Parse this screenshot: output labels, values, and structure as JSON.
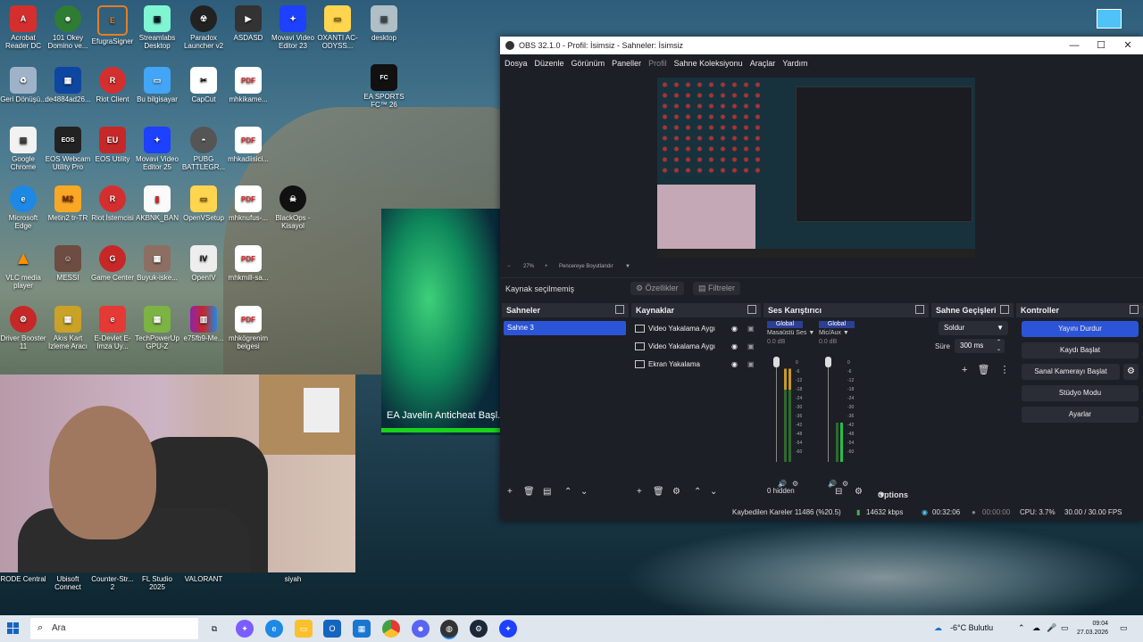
{
  "desktop": {
    "icons_col1": [
      "Acrobat Reader DC",
      "Geri Dönüşü...",
      "Google Chrome",
      "Microsoft Edge",
      "VLC media player",
      "Driver Booster 11"
    ],
    "icons_col2": [
      "101 Okey Domino ve...",
      "de4884ad26...",
      "EOS Webcam Utility Pro",
      "Metin2 tr-TR",
      "MESSI",
      "Akıs Kart İzleme Aracı"
    ],
    "icons_col3": [
      "EfugraSigner",
      "Riot Client",
      "EOS Utility",
      "Riot İstemcisi",
      "Game Center",
      "E-Devlet E-İmza Uy..."
    ],
    "icons_col4": [
      "Streamlabs Desktop",
      "Bu bilgisayar",
      "Movavi Video Editor 25",
      "AKBNK_BAN",
      "Buyuk-iske...",
      "TechPowerUp GPU-Z"
    ],
    "icons_col5": [
      "Paradox Launcher v2",
      "CapCut",
      "PUBG BATTLEGR...",
      "OpenVSetup",
      "OpenIV",
      "e75fb9-Me..."
    ],
    "icons_col6": [
      "ASDASD",
      "mhkikame...",
      "mhkadiisici...",
      "mhknufus-...",
      "mhkmill-sa...",
      "mhkögrenim belgesi"
    ],
    "icons_col7": [
      "Movavi Video Editor 23",
      "BlackOps - Kisayol"
    ],
    "icons_col8": [
      "OXANTI AC-ODYSS..."
    ],
    "icons_col9": [
      "desktop",
      "EA SPORTS FC™ 26"
    ],
    "bottom_icons": [
      "RODE Central",
      "Ubisoft Connect",
      "Counter-Str... 2",
      "FL Studio 2025",
      "VALORANT",
      "siyah"
    ],
    "green_window_text": "EA Javelin Anticheat Başl..."
  },
  "obs": {
    "title": "OBS 32.1.0 - Profil: İsimsiz - Sahneler: İsimsiz",
    "window_buttons": [
      "—",
      "☐",
      "✕"
    ],
    "menu": [
      "Dosya",
      "Düzenle",
      "Görünüm",
      "Paneller",
      "Profil",
      "Sahne Koleksiyonu",
      "Araçlar",
      "Yardım"
    ],
    "zoom": "27%",
    "fit_label": "Pencereye Boyutlandır",
    "no_source_label": "Kaynak seçilmemiş",
    "properties_label": "Özellikler",
    "filters_label": "Filtreler",
    "scenes": {
      "title": "Sahneler",
      "items": [
        "Sahne 3"
      ]
    },
    "sources": {
      "title": "Kaynaklar",
      "items": [
        "Video Yakalama Aygı",
        "Video Yakalama Aygı",
        "Ekran Yakalama"
      ]
    },
    "mixer": {
      "title": "Ses Karıştırıcı",
      "channels": [
        {
          "global": "Global",
          "name": "Masaüstü Ses",
          "db": "0.0 dB"
        },
        {
          "global": "Global",
          "name": "Mic/Aux",
          "db": "0.0 dB"
        }
      ],
      "scale": [
        "0",
        "-6",
        "-12",
        "-18",
        "-24",
        "-30",
        "-36",
        "-42",
        "-48",
        "-54",
        "-60"
      ],
      "hidden_label": "0 hidden",
      "options_label": "Options"
    },
    "transitions": {
      "title": "Sahne Geçişleri",
      "type": "Soldur",
      "duration_label": "Süre",
      "duration": "300 ms"
    },
    "controls": {
      "title": "Kontroller",
      "buttons": [
        "Yayını Durdur",
        "Kaydı Başlat",
        "Sanal Kamerayı Başlat",
        "Stüdyo Modu",
        "Ayarlar"
      ]
    },
    "status": {
      "dropped": "Kaybedilen Kareler 11486 (%20.5)",
      "bitrate": "14632 kbps",
      "stream_time": "00:32:06",
      "rec_time": "00:00:00",
      "cpu": "CPU: 3.7%",
      "fps": "30.00 / 30.00 FPS"
    }
  },
  "taskbar": {
    "search_placeholder": "Ara",
    "weather": "-6°C Bulutlu",
    "time": "09:04",
    "date": "27.03.2026"
  },
  "colors": {
    "accent": "#2b54d6",
    "obs_bg": "#1d1f26",
    "dock_head": "#2b2d36"
  }
}
